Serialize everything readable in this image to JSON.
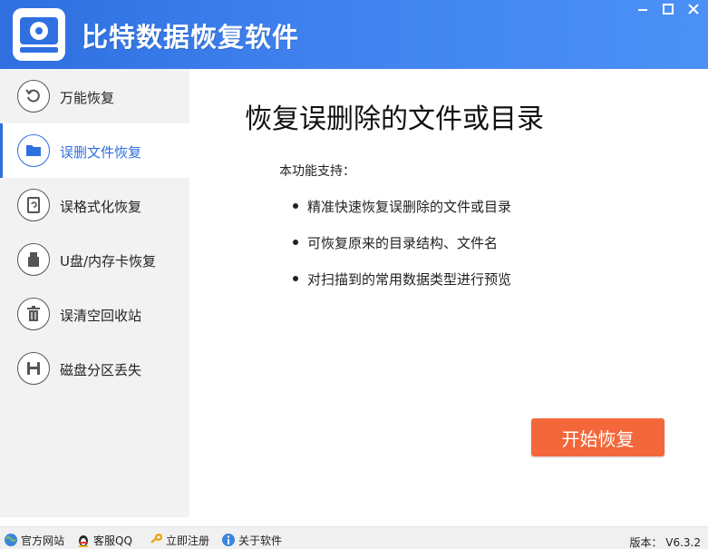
{
  "window": {
    "title": "比特数据恢复软件",
    "icons": {
      "logo": "disk-logo-icon",
      "minimize": "minimize-icon",
      "maximize": "maximize-icon",
      "close": "close-icon"
    },
    "colors": {
      "titlebar": "#3f82ef",
      "accent": "#2f6fe0",
      "button": "#f4673a"
    }
  },
  "sidebar": {
    "items": [
      {
        "label": "万能恢复",
        "icon": "restore-icon"
      },
      {
        "label": "误删文件恢复",
        "icon": "folder-icon",
        "active": true
      },
      {
        "label": "误格式化恢复",
        "icon": "disk-format-icon"
      },
      {
        "label": "U盘/内存卡恢复",
        "icon": "usb-drive-icon"
      },
      {
        "label": "误清空回收站",
        "icon": "trash-icon"
      },
      {
        "label": "磁盘分区丢失",
        "icon": "floppy-disk-icon"
      }
    ]
  },
  "main": {
    "title": "恢复误删除的文件或目录",
    "support_label": "本功能支持：",
    "features": [
      "精准快速恢复误删除的文件或目录",
      "可恢复原来的目录结构、文件名",
      "对扫描到的常用数据类型进行预览"
    ],
    "start_button": "开始恢复"
  },
  "statusbar": {
    "links": [
      {
        "label": "官方网站",
        "icon": "globe-icon"
      },
      {
        "label": "客服QQ",
        "icon": "qq-penguin-icon"
      },
      {
        "label": "立即注册",
        "icon": "key-icon"
      },
      {
        "label": "关于软件",
        "icon": "info-globe-icon"
      }
    ],
    "version": "版本： V6.3.2"
  }
}
